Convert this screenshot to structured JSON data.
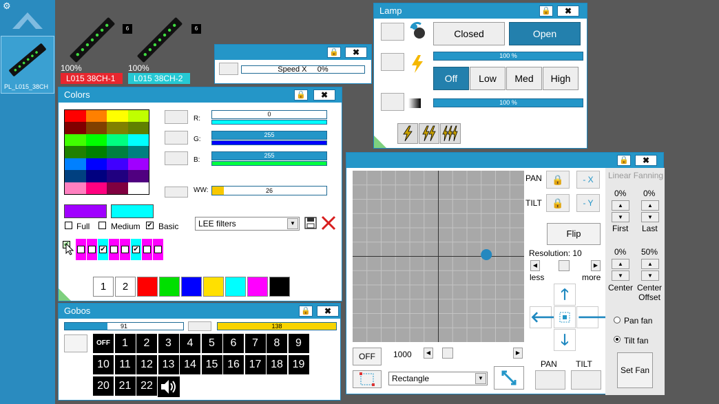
{
  "sidebar": {
    "gear_icon": "gear-icon",
    "up_icon": "chevron-up-icon",
    "fixture_label": "PL_L015_38CH"
  },
  "fixtures": [
    {
      "percent": "100%",
      "label": "L015 38CH-1",
      "color": "#e8262e",
      "badge": "6"
    },
    {
      "percent": "100%",
      "label": "L015 38CH-2",
      "color": "#26c9d4",
      "badge": "6"
    }
  ],
  "speed_window": {
    "lock": "🔒",
    "close": "✖",
    "text": "Speed X     0%"
  },
  "lamp": {
    "title": "Lamp",
    "lock": "🔒",
    "close": "✖",
    "closed": "Closed",
    "open": "Open",
    "lamp_pct": "100 %",
    "lamp_level": 1.0,
    "power_buttons": [
      "Off",
      "Low",
      "Med",
      "High"
    ],
    "dimmer_pct": "100 %",
    "dimmer_level": 1.0
  },
  "colors": {
    "title": "Colors",
    "lock": "🔒",
    "close": "✖",
    "palette": [
      [
        "#ff0000",
        "#ff8000",
        "#ffff00",
        "#c0ff00"
      ],
      [
        "#800000",
        "#804000",
        "#808000",
        "#608000"
      ],
      [
        "#40ff00",
        "#00ff00",
        "#00ff80",
        "#00ffff"
      ],
      [
        "#208000",
        "#008000",
        "#008040",
        "#008080"
      ],
      [
        "#0080ff",
        "#0000ff",
        "#4000ff",
        "#a000ff"
      ],
      [
        "#004080",
        "#000080",
        "#200080",
        "#500080"
      ],
      [
        "#ff80c0",
        "#ff0080",
        "#800040",
        "#ffffff"
      ]
    ],
    "channels": [
      {
        "label": "R:",
        "value": "0",
        "level": 0.0,
        "track": "#00ffff"
      },
      {
        "label": "G:",
        "value": "255",
        "level": 1.0,
        "track": "#0000ff"
      },
      {
        "label": "B:",
        "value": "255",
        "level": 1.0,
        "track": "#00ff40"
      }
    ],
    "ww": {
      "label": "WW:",
      "value": "26",
      "level": 0.1
    },
    "swatch_a": "#a000ff",
    "swatch_b": "#00ffff",
    "modes": [
      {
        "label": "Full",
        "checked": ""
      },
      {
        "label": "Medium",
        "checked": ""
      },
      {
        "label": "Basic",
        "checked": "✔"
      }
    ],
    "filter": "LEE filters",
    "cells": [
      {
        "color": "#ff00ff",
        "checked": ""
      },
      {
        "color": "#ff00ff",
        "checked": ""
      },
      {
        "color": "#00ffff",
        "checked": "✔"
      },
      {
        "color": "#ff00ff",
        "checked": ""
      },
      {
        "color": "#ff00ff",
        "checked": ""
      },
      {
        "color": "#00ffff",
        "checked": "✔"
      },
      {
        "color": "#ff00ff",
        "checked": ""
      },
      {
        "color": "#ff00ff",
        "checked": ""
      }
    ],
    "presets": [
      {
        "label": "1",
        "color": "#ffffff"
      },
      {
        "label": "2",
        "color": "#ffffff"
      },
      {
        "label": "",
        "color": "#ff0000"
      },
      {
        "label": "",
        "color": "#00e000"
      },
      {
        "label": "",
        "color": "#0000ff"
      },
      {
        "label": "",
        "color": "#ffe000"
      },
      {
        "label": "",
        "color": "#00ffff"
      },
      {
        "label": "",
        "color": "#ff00ff"
      },
      {
        "label": "",
        "color": "#000000"
      }
    ]
  },
  "gobos": {
    "title": "Gobos",
    "lock": "🔒",
    "close": "✖",
    "bar1_value": "91",
    "bar1_level": 0.36,
    "bar2_value": "138",
    "bar2_level": 1.0,
    "row1": [
      "OFF",
      "1",
      "2",
      "3",
      "4",
      "5",
      "6",
      "7",
      "8",
      "9"
    ],
    "row2": [
      "10",
      "11",
      "12",
      "13",
      "14",
      "15",
      "16",
      "17",
      "18",
      "19"
    ],
    "row3": [
      "20",
      "21",
      "22"
    ]
  },
  "pantilt": {
    "lock": "🔒",
    "close": "✖",
    "pan": "PAN",
    "tilt": "TILT",
    "neg_x": "- X",
    "neg_y": "- Y",
    "flip": "Flip",
    "resolution": "Resolution: 10",
    "less": "less",
    "more": "more",
    "off": "OFF",
    "speed": "1000",
    "shape": "Rectangle",
    "pan_label": "PAN",
    "tilt_label": "TILT",
    "point_x": 0.78,
    "point_y": 0.49
  },
  "fanning": {
    "title": "Linear Fanning",
    "first_pct": "0%",
    "last_pct": "0%",
    "first": "First",
    "last": "Last",
    "center_pct": "0%",
    "offset_pct": "50%",
    "center": "Center",
    "offset": "Center\nOffset",
    "pan_fan": "Pan fan",
    "tilt_fan": "Tilt fan",
    "set_fan": "Set Fan"
  }
}
